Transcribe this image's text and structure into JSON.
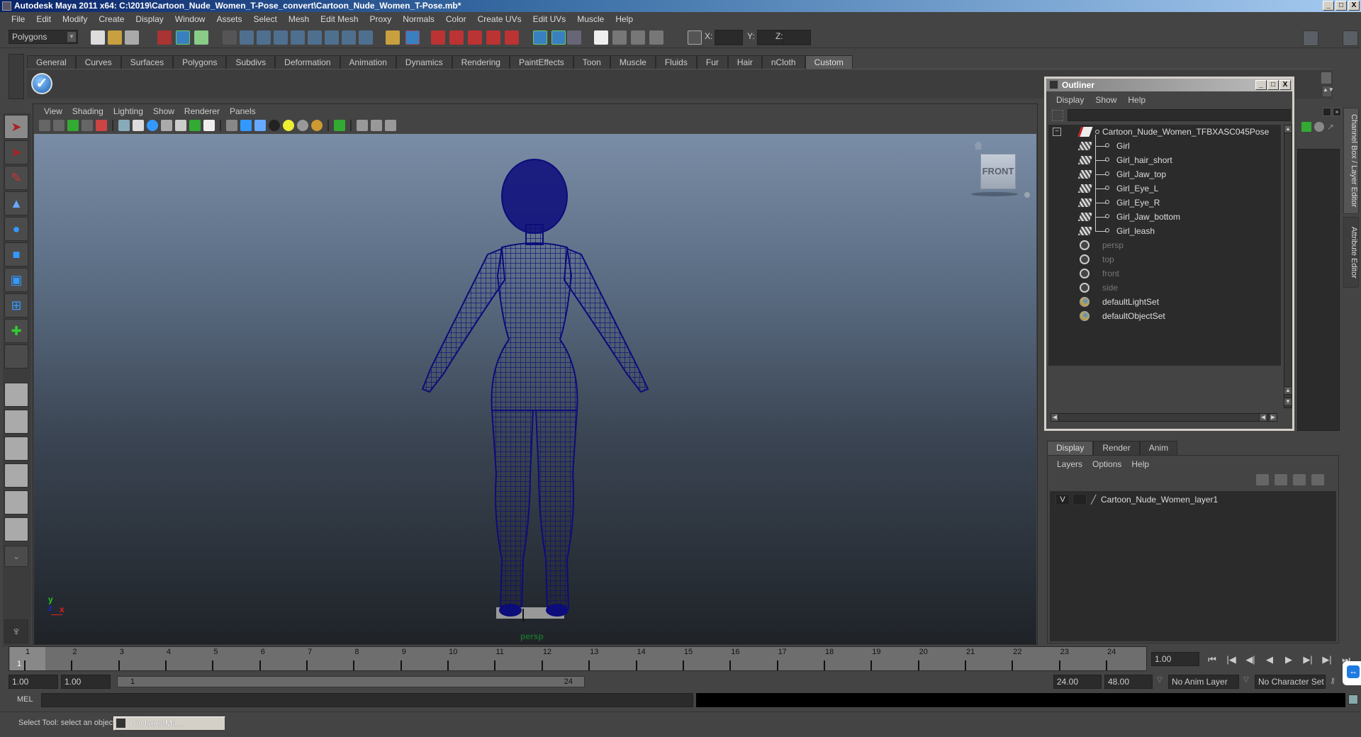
{
  "window": {
    "title": "Autodesk Maya 2011 x64: C:\\2019\\Cartoon_Nude_Women_T-Pose_convert\\Cartoon_Nude_Women_T-Pose.mb*",
    "minimize": "_",
    "maximize": "□",
    "close": "X"
  },
  "menubar": [
    "File",
    "Edit",
    "Modify",
    "Create",
    "Display",
    "Window",
    "Assets",
    "Select",
    "Mesh",
    "Edit Mesh",
    "Proxy",
    "Normals",
    "Color",
    "Create UVs",
    "Edit UVs",
    "Muscle",
    "Help"
  ],
  "statusline": {
    "mode": "Polygons",
    "x_label": "X:",
    "y_label": "Y:",
    "z_label": "Z:",
    "x_value": "",
    "y_value": "",
    "z_value": ""
  },
  "shelf": {
    "tabs": [
      "General",
      "Curves",
      "Surfaces",
      "Polygons",
      "Subdivs",
      "Deformation",
      "Animation",
      "Dynamics",
      "Rendering",
      "PaintEffects",
      "Toon",
      "Muscle",
      "Fluids",
      "Fur",
      "Hair",
      "nCloth",
      "Custom"
    ],
    "active_tab": "Custom",
    "check_icon": "✓"
  },
  "toolbox": {
    "tools": [
      "select-tool",
      "lasso-tool",
      "paint-select-tool",
      "move-tool",
      "rotate-tool",
      "scale-tool",
      "universal-manipulator",
      "soft-mod-tool",
      "show-manipulator",
      "last-tool"
    ],
    "layouts": [
      "single-perspective",
      "four-view",
      "outliner-persp",
      "persp-graph",
      "hypershade-persp",
      "persp-outliner-graph"
    ],
    "expand": "⌄"
  },
  "viewport": {
    "menu": [
      "View",
      "Shading",
      "Lighting",
      "Show",
      "Renderer",
      "Panels"
    ],
    "camera_label": "persp",
    "viewcube_label": "FRONT",
    "axis": {
      "y": "y",
      "z": "z",
      "x": "x"
    },
    "wire_color": "#0c0c7a"
  },
  "outliner": {
    "title": "Outliner",
    "menu": [
      "Display",
      "Show",
      "Help"
    ],
    "filter_value": "",
    "root": "Cartoon_Nude_Women_TFBXASC045Pose",
    "children": [
      "Girl",
      "Girl_hair_short",
      "Girl_Jaw_top",
      "Girl_Eye_L",
      "Girl_Eye_R",
      "Girl_Jaw_bottom",
      "Girl_leash"
    ],
    "cameras": [
      "persp",
      "top",
      "front",
      "side"
    ],
    "sets": [
      "defaultLightSet",
      "defaultObjectSet"
    ]
  },
  "side_tabs": [
    "Channel Box / Layer Editor",
    "Attribute Editor"
  ],
  "layer_editor": {
    "tabs": [
      "Display",
      "Render",
      "Anim"
    ],
    "active_tab": "Display",
    "menu": [
      "Layers",
      "Options",
      "Help"
    ],
    "layers": [
      {
        "visible": "V",
        "name": "Cartoon_Nude_Women_layer1"
      }
    ]
  },
  "timeline": {
    "frames": [
      "1",
      "2",
      "3",
      "4",
      "5",
      "6",
      "7",
      "8",
      "9",
      "10",
      "11",
      "12",
      "13",
      "14",
      "15",
      "16",
      "17",
      "18",
      "19",
      "20",
      "21",
      "22",
      "23",
      "24"
    ],
    "current_frame_marker": "1",
    "current_time": "1.00",
    "playback": [
      "⏮",
      "|◀",
      "◀|",
      "◀",
      "▶",
      "▶|",
      "▶|",
      "⏭"
    ]
  },
  "range": {
    "start_time": "1.00",
    "playback_start": "1.00",
    "slider_start": "1",
    "slider_end": "24",
    "playback_end": "24.00",
    "end_time": "48.00",
    "anim_layer": "No Anim Layer",
    "character_set": "No Character Set"
  },
  "command_line": {
    "label": "MEL",
    "value": "",
    "result": ""
  },
  "helpline": {
    "text": "Select Tool: select an object",
    "task_window": "C:\\Users\\Ma..."
  }
}
